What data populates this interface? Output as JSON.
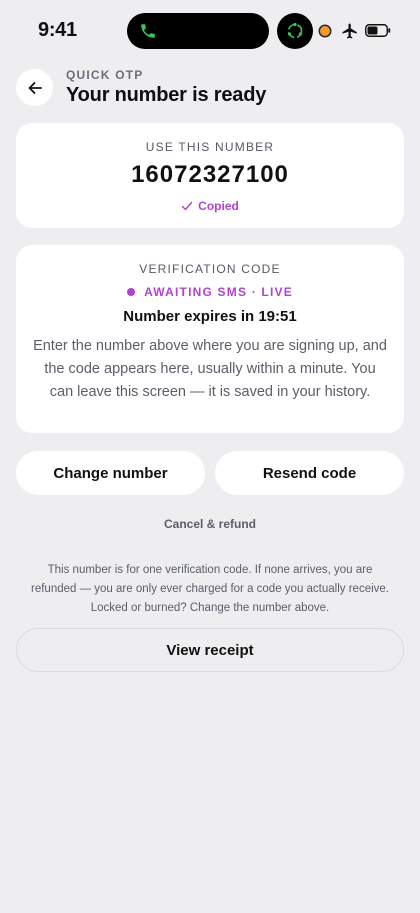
{
  "status_bar": {
    "time": "9:41"
  },
  "header": {
    "eyebrow": "QUICK OTP",
    "title": "Your number is ready"
  },
  "number_card": {
    "label": "USE THIS NUMBER",
    "phone_number": "16072327100",
    "copied_label": "Copied"
  },
  "code_card": {
    "label": "VERIFICATION CODE",
    "status": "AWAITING SMS · LIVE",
    "expires": "Number expires in 19:51",
    "instructions": "Enter the number above where you are signing up, and the code appears here, usually within a minute. You can leave this screen — it is saved in your history."
  },
  "actions": {
    "change_number": "Change number",
    "resend_code": "Resend code",
    "cancel_refund": "Cancel & refund",
    "view_receipt": "View receipt"
  },
  "disclaimer": "This number is for one verification code. If none arrives, you are refunded — you are only ever charged for a code you actually receive. Locked or burned? Change the number above.",
  "colors": {
    "accent": "#b044d0",
    "background": "#eeeef0",
    "card": "#ffffff",
    "call_green": "#34c759",
    "privacy_orange": "#f29a2e"
  }
}
